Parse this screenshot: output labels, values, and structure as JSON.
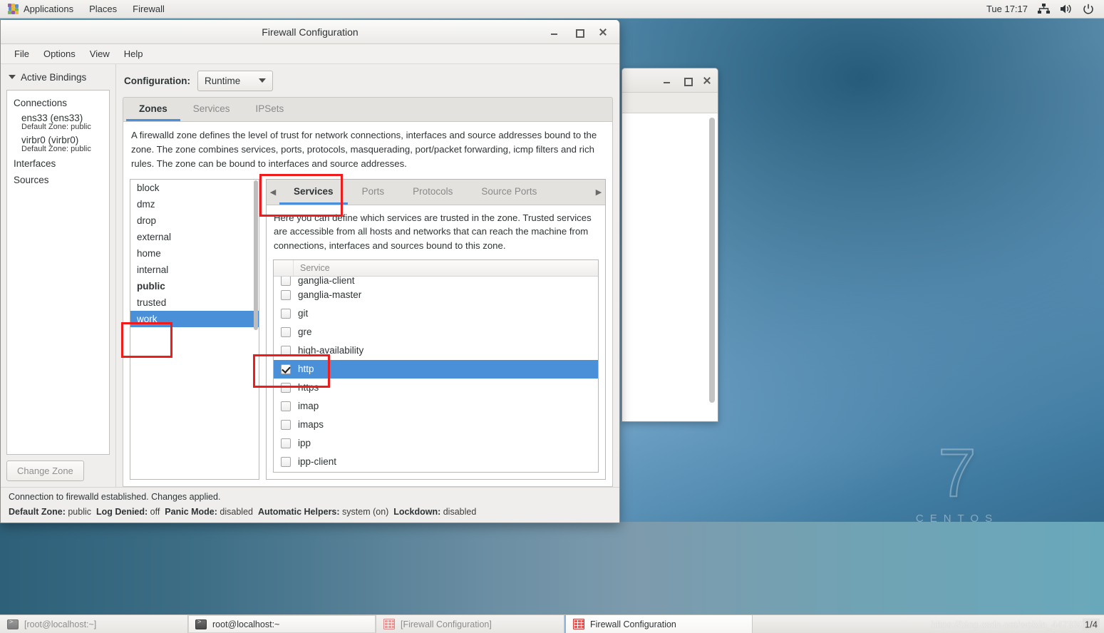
{
  "top_panel": {
    "applications_label": "Applications",
    "places_label": "Places",
    "app_name_label": "Firewall",
    "applications_icon": "centos-applications-icon",
    "clock": "Tue 17:17",
    "network_icon": "network-icon",
    "volume_icon": "volume-icon",
    "power_icon": "power-icon"
  },
  "window": {
    "title": "Firewall Configuration",
    "minimize_icon": "minimize-icon",
    "maximize_icon": "maximize-icon",
    "close_icon": "close-icon",
    "menus": [
      "File",
      "Options",
      "View",
      "Help"
    ]
  },
  "sidebar": {
    "header": "Active Bindings",
    "expander_icon": "chevron-down-icon",
    "groups": [
      {
        "label": "Connections"
      },
      {
        "label": "Interfaces"
      },
      {
        "label": "Sources"
      }
    ],
    "connections": [
      {
        "name": "ens33 (ens33)",
        "zone": "Default Zone: public"
      },
      {
        "name": "virbr0 (virbr0)",
        "zone": "Default Zone: public"
      }
    ],
    "change_zone_button": "Change Zone"
  },
  "config": {
    "label": "Configuration:",
    "selected": "Runtime",
    "dropdown_icon": "chevron-down-icon"
  },
  "outer_tabs": [
    {
      "label": "Zones",
      "active": true
    },
    {
      "label": "Services",
      "active": false
    },
    {
      "label": "IPSets",
      "active": false
    }
  ],
  "zone_description": "A firewalld zone defines the level of trust for network connections, interfaces and source addresses bound to the zone. The zone combines services, ports, protocols, masquerading, port/packet forwarding, icmp filters and rich rules. The zone can be bound to interfaces and source addresses.",
  "zones": [
    {
      "name": "block",
      "selected": false,
      "default": false
    },
    {
      "name": "dmz",
      "selected": false,
      "default": false
    },
    {
      "name": "drop",
      "selected": false,
      "default": false
    },
    {
      "name": "external",
      "selected": false,
      "default": false
    },
    {
      "name": "home",
      "selected": false,
      "default": false
    },
    {
      "name": "internal",
      "selected": false,
      "default": false
    },
    {
      "name": "public",
      "selected": false,
      "default": true
    },
    {
      "name": "trusted",
      "selected": false,
      "default": false
    },
    {
      "name": "work",
      "selected": true,
      "default": false
    }
  ],
  "inner_tabs": {
    "prev_icon": "chevron-left-icon",
    "next_icon": "chevron-right-icon",
    "items": [
      {
        "label": "Services",
        "active": true
      },
      {
        "label": "Ports",
        "active": false
      },
      {
        "label": "Protocols",
        "active": false
      },
      {
        "label": "Source Ports",
        "active": false
      }
    ]
  },
  "services_description": "Here you can define which services are trusted in the zone. Trusted services are accessible from all hosts and networks that can reach the machine from connections, interfaces and sources bound to this zone.",
  "services_table": {
    "column_header": "Service",
    "rows": [
      {
        "name": "ganglia-client",
        "checked": false,
        "selected": false
      },
      {
        "name": "ganglia-master",
        "checked": false,
        "selected": false
      },
      {
        "name": "git",
        "checked": false,
        "selected": false
      },
      {
        "name": "gre",
        "checked": false,
        "selected": false
      },
      {
        "name": "high-availability",
        "checked": false,
        "selected": false
      },
      {
        "name": "http",
        "checked": true,
        "selected": true
      },
      {
        "name": "https",
        "checked": false,
        "selected": false
      },
      {
        "name": "imap",
        "checked": false,
        "selected": false
      },
      {
        "name": "imaps",
        "checked": false,
        "selected": false
      },
      {
        "name": "ipp",
        "checked": false,
        "selected": false
      },
      {
        "name": "ipp-client",
        "checked": false,
        "selected": false
      }
    ]
  },
  "statusbar": {
    "message": "Connection to firewalld established.  Changes applied.",
    "fields": [
      {
        "label": "Default Zone:",
        "value": "public"
      },
      {
        "label": "Log Denied:",
        "value": "off"
      },
      {
        "label": "Panic Mode:",
        "value": "disabled"
      },
      {
        "label": "Automatic Helpers:",
        "value": "system (on)"
      },
      {
        "label": "Lockdown:",
        "value": "disabled"
      }
    ]
  },
  "desktop": {
    "logo_number": "7",
    "logo_word": "CENTOS"
  },
  "taskbar": {
    "tasks": [
      {
        "label": "[root@localhost:~]",
        "icon": "terminal-icon",
        "state": "minimized"
      },
      {
        "label": "root@localhost:~",
        "icon": "terminal-icon",
        "state": "normal"
      },
      {
        "label": "[Firewall Configuration]",
        "icon": "firewall-icon",
        "state": "minimized"
      },
      {
        "label": "Firewall Configuration",
        "icon": "firewall-icon",
        "state": "focused"
      }
    ],
    "watermark": "https://blog.csdn.net/weixin_44733024",
    "page_indicator": "1/4"
  },
  "colors": {
    "accent": "#4a90d9",
    "annotation": "#f01b1b",
    "panel_bg": "#f0eeec"
  }
}
